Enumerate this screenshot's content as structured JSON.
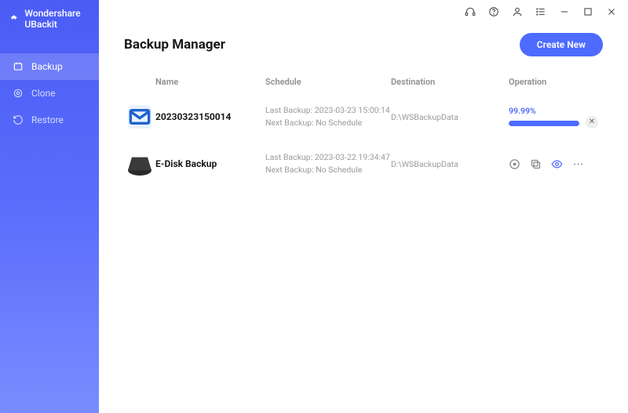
{
  "app_title": "Wondershare UBackit",
  "sidebar": {
    "items": [
      {
        "label": "Backup"
      },
      {
        "label": "Clone"
      },
      {
        "label": "Restore"
      }
    ]
  },
  "header": {
    "title": "Backup Manager",
    "create_label": "Create New"
  },
  "columns": {
    "name": "Name",
    "schedule": "Schedule",
    "destination": "Destination",
    "operation": "Operation"
  },
  "rows": [
    {
      "name": "20230323150014",
      "last": "Last Backup: 2023-03-23 15:00:14",
      "next": "Next Backup: No Schedule",
      "destination": "D:\\WSBackupData",
      "percent": "99.99%",
      "progress": 99.99
    },
    {
      "name": "E-Disk Backup",
      "last": "Last Backup: 2023-03-22 19:34:47",
      "next": "Next Backup: No Schedule",
      "destination": "D:\\WSBackupData"
    }
  ]
}
